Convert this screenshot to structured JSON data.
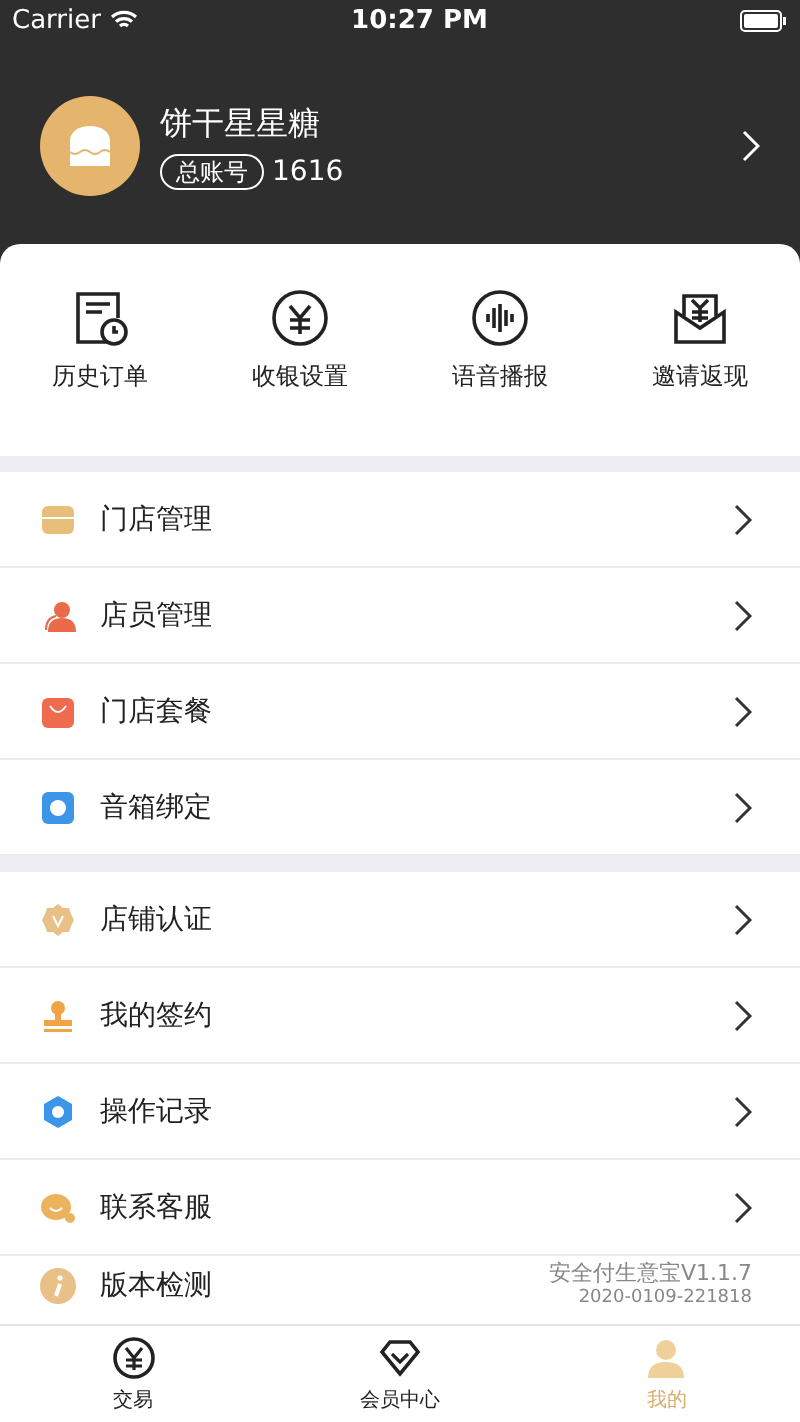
{
  "status_bar": {
    "carrier": "Carrier",
    "time": "10:27 PM"
  },
  "profile": {
    "name": "饼干星星糖",
    "account_label": "总账号",
    "account_number": "1616"
  },
  "quick_actions": [
    {
      "label": "历史订单"
    },
    {
      "label": "收银设置"
    },
    {
      "label": "语音播报"
    },
    {
      "label": "邀请返现"
    }
  ],
  "menu_groups": [
    {
      "items": [
        {
          "label": "门店管理"
        },
        {
          "label": "店员管理"
        },
        {
          "label": "门店套餐"
        },
        {
          "label": "音箱绑定"
        }
      ]
    },
    {
      "items": [
        {
          "label": "店铺认证"
        },
        {
          "label": "我的签约"
        },
        {
          "label": "操作记录"
        },
        {
          "label": "联系客服"
        }
      ]
    }
  ],
  "version_row": {
    "label": "版本检测",
    "version": "安全付生意宝V1.1.7",
    "build": "2020-0109-221818"
  },
  "tab_bar": [
    {
      "label": "交易",
      "selected": false
    },
    {
      "label": "会员中心",
      "selected": false
    },
    {
      "label": "我的",
      "selected": true
    }
  ]
}
